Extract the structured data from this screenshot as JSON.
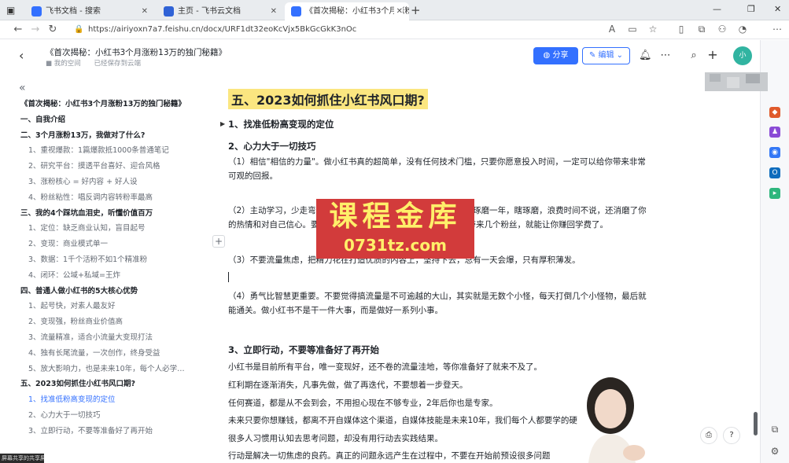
{
  "browser": {
    "tabs": [
      {
        "label": "飞书文档 - 搜索",
        "fav_color": "#3370ff"
      },
      {
        "label": "主页 - 飞书云文档",
        "fav_color": "#2f62d6"
      },
      {
        "label": "《首次揭秘：小红书3个月涨粉13…",
        "fav_color": "#3370ff"
      }
    ],
    "url": "https://airiyoxn7a7.feishu.cn/docx/URF1dt32eoKcVjx5BkGcGkK3nOc"
  },
  "doc": {
    "title": "《首次揭秘：小红书3个月涨粉13万的独门秘籍》",
    "space": "我的空间",
    "saved": "已经保存到云端",
    "share_label": "分享",
    "edit_label": "编辑",
    "avatar_text": "小"
  },
  "toc": [
    {
      "text": "《首次揭秘：小红书3个月涨粉13万的独门秘籍》",
      "level": "h"
    },
    {
      "text": "一、自我介绍",
      "level": "h"
    },
    {
      "text": "二、3个月涨粉13万，我做对了什么?",
      "level": "h"
    },
    {
      "text": "1、重视爆款：1篇爆款抵1000条普通笔记",
      "level": "s"
    },
    {
      "text": "2、研究平台：摸透平台喜好、迎合风格",
      "level": "s"
    },
    {
      "text": "3、涨粉核心 = 好内容 + 好人设",
      "level": "s"
    },
    {
      "text": "4、粉丝粘性：唱反调内容转粉率最高",
      "level": "s"
    },
    {
      "text": "三、我的4个踩坑血泪史，听懂价值百万",
      "level": "h"
    },
    {
      "text": "1、定位：缺乏商业认知，盲目起号",
      "level": "s"
    },
    {
      "text": "2、变现：商业模式单一",
      "level": "s"
    },
    {
      "text": "3、数据：1千个活粉不如1个精准粉",
      "level": "s"
    },
    {
      "text": "4、闭环：公域+私域=王炸",
      "level": "s"
    },
    {
      "text": "四、普通人做小红书的5大核心优势",
      "level": "h"
    },
    {
      "text": "1、起号快，对素人最友好",
      "level": "s"
    },
    {
      "text": "2、变现强，粉丝商业价值高",
      "level": "s"
    },
    {
      "text": "3、流量精准，适合小流量大变现打法",
      "level": "s"
    },
    {
      "text": "4、独有长尾流量，一次创作，终身受益",
      "level": "s"
    },
    {
      "text": "5、放大影响力，也是未来10年，每个人必学的赚…",
      "level": "s"
    },
    {
      "text": "五、2023如何抓住小红书风口期?",
      "level": "h"
    },
    {
      "text": "1、找准低粉高变现的定位",
      "level": "a"
    },
    {
      "text": "2、心力大于一切技巧",
      "level": "s"
    },
    {
      "text": "3、立即行动，不要等准备好了再开始",
      "level": "s"
    }
  ],
  "content": {
    "h1": "五、2023如何抓住小红书风口期?",
    "h3_1": "1、找准低粉高变现的定位",
    "h3_2": "2、心力大于一切技巧",
    "p1": "（1）相信\"相信的力量\"。做小红书真的超简单，没有任何技术门槛，只要你愿意投入时间，一定可以给你带来非常可观的回报。",
    "p2": "（2）主动学习，少走弯路，别人踩过的坑你不用再踩，自己一个人琢磨一年，瞎琢磨，浪费时间不说，还消磨了你的热情和对自己信心。要舍得投资自己，哪怕是一个小小的技巧，带来几个粉丝，就能让你赚回学费了。",
    "p3": "（3）不要流量焦虑，把精力花在打造优质的内容上，坚持下去，总有一天会爆，只有厚积薄发。",
    "p4": "（4）勇气比智慧更重要。不要觉得搞流量是不可逾越的大山，其实就是无数个小怪，每天打倒几个小怪物，最后就能通关。做小红书不是干一件大事，而是做好一系列小事。",
    "h3_3": "3、立即行动，不要等准备好了再开始",
    "p5": "小红书是目前所有平台，唯一变现好，还不卷的流量洼地，等你准备好了就来不及了。",
    "p6": "红利期在逐渐消失，凡事先做，做了再迭代，不要想着一步登天。",
    "p7": "任何赛道，都是从不会到会，不用担心现在不够专业，2年后你也是专家。",
    "p8": "未来只要你想赚钱，都离不开自媒体这个渠道，自媒体技能是未来10年，我们每个人都要学的硬",
    "p9": "很多人习惯用认知去思考问题，却没有用行动去实践结果。",
    "p10": "行动是解决一切焦虑的良药。真正的问题永远产生在过程中，不要在开始前预设很多问题"
  },
  "watermark": {
    "title": "课程金库",
    "url": "0731tz.com"
  },
  "share_tag": "屏幕共享的共享屏幕"
}
